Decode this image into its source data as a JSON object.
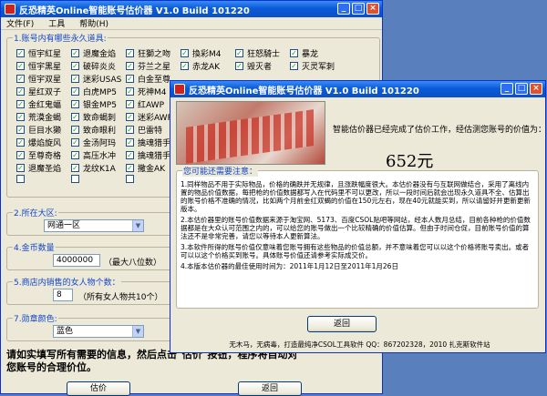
{
  "main": {
    "title": "反恐精英Online智能账号估价器 V1.0 Build 101220",
    "menu": [
      "文件(F)",
      "工具",
      "帮助(H)"
    ],
    "section1_label": "1.账号内有哪些永久道具:",
    "items": [
      "恒宇紅星",
      "退魔金焰",
      "狂獅之吻",
      "換彩M4",
      "狂怒騎士",
      "暴龙",
      "恒宇黑星",
      "破碎炎炎",
      "芬兰之星",
      "赤龙AK",
      "毁灭者",
      "灭灵军刺",
      "恒宇双星",
      "迷彩USAS",
      "白金至尊",
      "",
      "星红双子",
      "白虎MP5",
      "死神M4",
      "",
      "金红鬼蝠",
      "银金MP5",
      "红AWP",
      "",
      "荒漠金蝎",
      "致命蝎刺",
      "迷彩AWP",
      "",
      "巨目水獭",
      "致命眼利",
      "巴雷特",
      "",
      "爆焰旋风",
      "金汤阿玛",
      "擒魂猎手",
      "",
      "至尊奇格",
      "高压水冲",
      "擒魂猎手",
      "",
      "退魔圣焰",
      "龙纹K1A",
      "撒金AK",
      "",
      "",
      "",
      "",
      ""
    ],
    "section2_label": "2.所在大区:",
    "region": "网通一区",
    "section4_label": "4.金币数量",
    "gold": "4000000",
    "gold_hint": "（最大八位数）",
    "section5_label": "5.商店内销售的女人物个数：",
    "female_count": "8",
    "female_hint": "（所有女人物共10个）",
    "section7_label": "7.勋章颜色:",
    "medal": "蓝色",
    "footer_line1": "请如实填写所有需要的信息，然后点击\"估价\"按钮，程序将自动对",
    "footer_line2": "您账号的合理价位。",
    "btn_estimate": "估价",
    "btn_back": "返回"
  },
  "dialog": {
    "title": "反恐精英Online智能账号估价器 V1.0 Build 101220",
    "message": "智能估价器已经完成了估价工作，经估测您账号的价值为：",
    "price": "652元",
    "notice_title": "您可能还需要注意：",
    "notes": [
      "1.同样物品不用于实际物品，价格的确跌并无规律，且涨跌幅度很大。本估价器没有与互联网做结合，采用了离线内置的物品价值数据，每把枪的价值数据都写入在代码里不可以更改，所以一段时间后就会出现永久道具不全、估算出的账号价格不准确的情况，比如两个月前金红双蝎的价值在150元左右，现在40元就能买到，所以请留好并更新更新版本。",
      "2.本估价器里的账号价值数据来源于淘宝网、5173、百度CSOL贴吧等网站，经本人数月总结，目前各种枪的价值数据都是在大众认可范围之内的，可以给您的账号做出一个比较精确的价值估算。但由于时间仓促，目前账号价值的算法还不是非常完善，请您以等待本人更新算法。",
      "3.本软件所得的账号价值仅意味着您账号拥有这些物品的价值总额，并不意味着您可以以这个价格将账号卖出。或者可以以这个价格买到账号。具体账号价值还请参考实际成交价。",
      "4.本版本估价器的最佳使用时间为：2011年1月12日至2011年1月26日"
    ],
    "back_button": "返回",
    "footer": "无木马，无病毒，打造最纯净CSOL工具软件 QQ：867202328，2010 扎克斯软件站"
  },
  "colors": {
    "titlebar": "#0a5bd9",
    "desktop": "#5a7fbd",
    "price_text": "#000000",
    "link_blue": "#1446c8"
  }
}
